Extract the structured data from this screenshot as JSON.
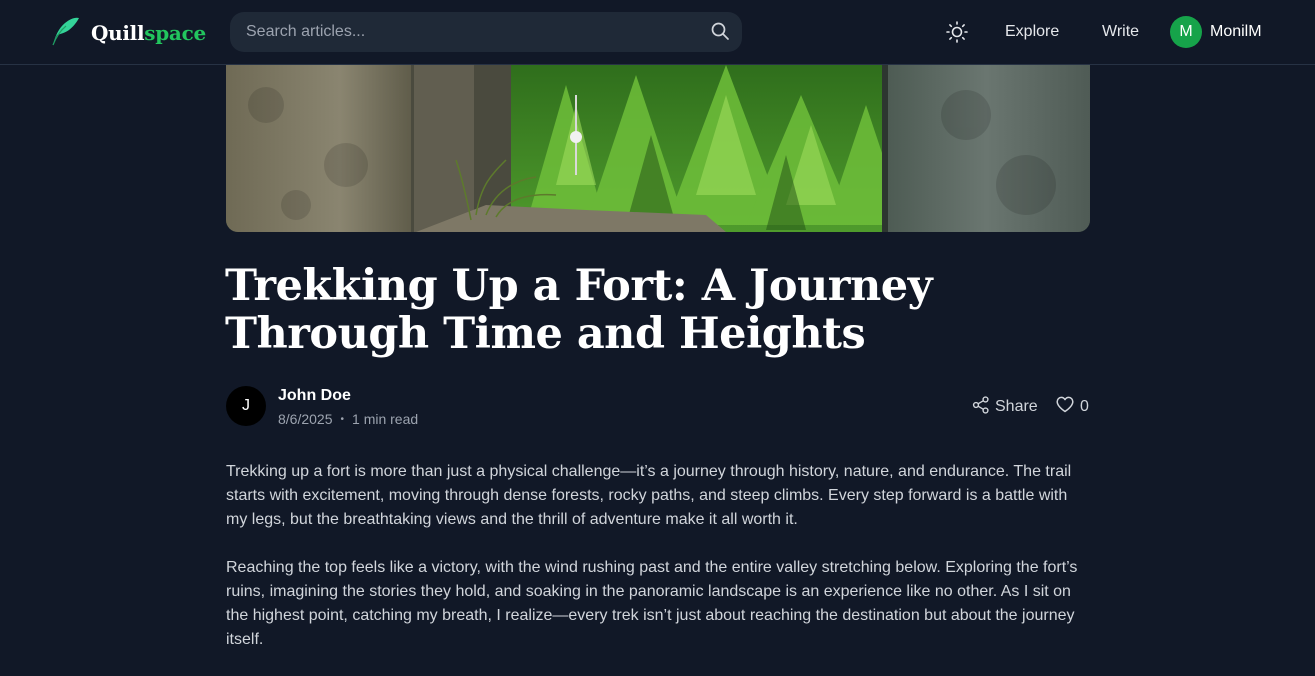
{
  "nav": {
    "logo_part1": "Quill",
    "logo_part2": "space",
    "search_placeholder": "Search articles...",
    "explore_label": "Explore",
    "write_label": "Write",
    "user_initial": "M",
    "user_name": "MonilM"
  },
  "article": {
    "title": "Trekking Up a Fort: A Journey Through Time and Heights",
    "author": {
      "initial": "J",
      "name": "John Doe"
    },
    "date": "8/6/2025",
    "separator": "•",
    "read_time": "1 min read",
    "share_label": "Share",
    "like_count": "0",
    "paragraphs": [
      "Trekking up a fort is more than just a physical challenge—it’s a journey through history, nature, and endurance. The trail starts with excitement, moving through dense forests, rocky paths, and steep climbs. Every step forward is a battle with my legs, but the breathtaking views and the thrill of adventure make it all worth it.",
      "Reaching the top feels like a victory, with the wind rushing past and the entire valley stretching below. Exploring the fort’s ruins, imagining the stories they hold, and soaking in the panoramic landscape is an experience like no other. As I sit on the highest point, catching my breath, I realize—every trek isn’t just about reaching the destination but about the journey itself."
    ]
  },
  "icons": {
    "logo": "feather-icon",
    "search": "search-icon",
    "theme": "sun-icon",
    "share": "share-icon",
    "like": "heart-icon"
  },
  "colors": {
    "background": "#111827",
    "accent": "#22c55e",
    "user_avatar": "#16a34a",
    "search_bg": "#1f2937"
  }
}
